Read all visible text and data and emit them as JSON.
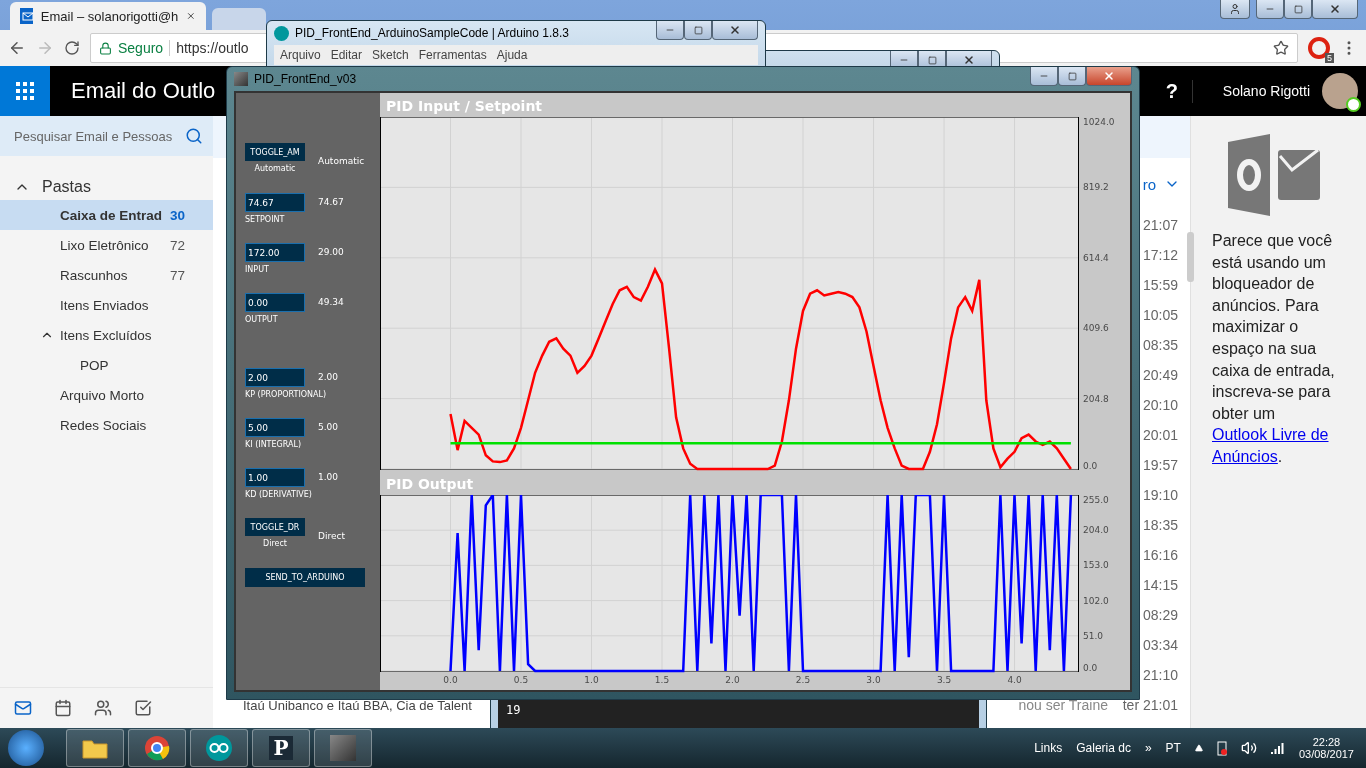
{
  "browser": {
    "tabs": [
      {
        "title": "Email – solanorigotti@h",
        "selected": true
      },
      {
        "selected": false
      }
    ],
    "address_bar": {
      "security": "Seguro",
      "url": "https://outlo"
    },
    "extension_badge": "5"
  },
  "outlook": {
    "app_title": "Email do Outlo",
    "help": "?",
    "user_name": "Solano Rigotti",
    "search": {
      "placeholder": "Pesquisar Email e Pessoas"
    },
    "folders_header": {
      "label": "Pastas",
      "expanded": true
    },
    "folders": [
      {
        "name": "Caixa de Entrad",
        "count": "30",
        "selected": true,
        "expanded": false
      },
      {
        "name": "Lixo Eletrônico",
        "count": "72",
        "selected": false,
        "expanded": false
      },
      {
        "name": "Rascunhos",
        "count": "77",
        "selected": false,
        "expanded": false
      },
      {
        "name": "Itens Enviados",
        "selected": false,
        "expanded": false
      },
      {
        "name": "Itens Excluídos",
        "selected": false,
        "expanded": true,
        "children": [
          {
            "name": "POP",
            "selected": false,
            "expanded": false
          }
        ]
      },
      {
        "name": "Arquivo Morto",
        "selected": false,
        "expanded": false
      },
      {
        "name": "Redes Sociais",
        "selected": false,
        "expanded": false
      }
    ],
    "filter_label": "ro",
    "messages": [
      {
        "time": "21:07"
      },
      {
        "time": "17:12"
      },
      {
        "time": "15:59"
      },
      {
        "time": "10:05"
      },
      {
        "time": "08:35"
      },
      {
        "time": "20:49"
      },
      {
        "time": "20:10"
      },
      {
        "time": "20:01"
      },
      {
        "time": "19:57"
      },
      {
        "time": "19:10"
      },
      {
        "time": "18:35"
      },
      {
        "time": "16:16"
      },
      {
        "time": "14:15"
      },
      {
        "time": "08:29"
      },
      {
        "time": "03:34"
      },
      {
        "time": "21:10"
      },
      {
        "subject": "Itaú Unibanco e Itaú BBA, Cia de Talent",
        "preview": "nou ser Traine",
        "time": "ter 21:01"
      }
    ],
    "ad_text": "Parece que você está usando um bloqueador de anúncios. Para maximizar o espaço na sua caixa de entrada, inscreva-se para obter um",
    "ad_link": [
      "Outlook Livre de",
      "Anúncios"
    ],
    "ad_end": "."
  },
  "arduino": {
    "title": "PID_FrontEnd_ArduinoSampleCode | Arduino 1.8.3",
    "menu": [
      "Arquivo",
      "Editar",
      "Sketch",
      "Ferramentas",
      "Ajuda"
    ],
    "console_line": "19"
  },
  "pid": {
    "title": "PID_FrontEnd_v03",
    "controls": [
      {
        "kind": "toggle",
        "button": "TOGGLE_AM",
        "label": "Automatic",
        "value": "Automatic"
      },
      {
        "kind": "field",
        "field": "74.67",
        "label": "SETPOINT",
        "value": "74.67"
      },
      {
        "kind": "field",
        "field": "172.00",
        "label": "INPUT",
        "value": "29.00"
      },
      {
        "kind": "field",
        "field": "0.00",
        "label": "OUTPUT",
        "value": "49.34"
      },
      {
        "kind": "field",
        "field": "2.00",
        "label": "KP (PROPORTIONAL)",
        "value": "2.00"
      },
      {
        "kind": "field",
        "field": "5.00",
        "label": "KI (INTEGRAL)",
        "value": "5.00"
      },
      {
        "kind": "field",
        "field": "1.00",
        "label": "KD (DERIVATIVE)",
        "value": "1.00"
      },
      {
        "kind": "toggle",
        "button": "TOGGLE_DR",
        "label": "Direct",
        "value": "Direct"
      }
    ],
    "send_button": "SEND_TO_ARDUINO",
    "charts": [
      {
        "title": "PID Input / Setpoint",
        "chart_data": {
          "type": "line",
          "grid": true,
          "xlim": [
            -0.5,
            4.45
          ],
          "ylim": [
            0,
            1024
          ],
          "yticks": [
            {
              "value": 0,
              "label": "0.0"
            },
            {
              "value": 204.8,
              "label": "204.8"
            },
            {
              "value": 409.6,
              "label": "409.6"
            },
            {
              "value": 614.4,
              "label": "614.4"
            },
            {
              "value": 819.2,
              "label": "819.2"
            },
            {
              "value": 1024,
              "label": "1024.0"
            }
          ],
          "x": [
            0,
            0.05,
            0.1,
            0.15,
            0.2,
            0.25,
            0.3,
            0.35,
            0.4,
            0.45,
            0.5,
            0.55,
            0.6,
            0.65,
            0.7,
            0.75,
            0.8,
            0.85,
            0.9,
            0.95,
            1,
            1.05,
            1.1,
            1.15,
            1.2,
            1.25,
            1.3,
            1.35,
            1.4,
            1.45,
            1.5,
            1.55,
            1.6,
            1.65,
            1.7,
            1.75,
            1.8,
            1.85,
            1.9,
            1.95,
            2,
            2.05,
            2.1,
            2.15,
            2.2,
            2.25,
            2.3,
            2.35,
            2.4,
            2.45,
            2.5,
            2.55,
            2.6,
            2.65,
            2.7,
            2.75,
            2.8,
            2.85,
            2.9,
            2.95,
            3,
            3.05,
            3.1,
            3.15,
            3.2,
            3.25,
            3.3,
            3.35,
            3.4,
            3.45,
            3.5,
            3.55,
            3.6,
            3.65,
            3.7,
            3.75,
            3.8,
            3.85,
            3.9,
            3.95,
            4,
            4.05,
            4.1,
            4.15,
            4.2,
            4.25,
            4.3,
            4.35,
            4.4
          ],
          "series": [
            {
              "color": "#ff0000",
              "values": [
                160,
                55,
                140,
                120,
                100,
                40,
                22,
                20,
                25,
                60,
                120,
                200,
                280,
                330,
                370,
                380,
                350,
                330,
                280,
                300,
                330,
                380,
                430,
                480,
                520,
                530,
                500,
                490,
                530,
                580,
                540,
                350,
                150,
                60,
                15,
                0,
                0,
                0,
                0,
                0,
                0,
                0,
                0,
                0,
                0,
                0,
                10,
                80,
                200,
                350,
                460,
                510,
                520,
                505,
                510,
                515,
                510,
                500,
                470,
                400,
                300,
                200,
                120,
                60,
                10,
                0,
                0,
                0,
                50,
                130,
                250,
                380,
                470,
                500,
                460,
                550,
                200,
                60,
                5,
                30,
                50,
                90,
                100,
                80,
                70,
                80,
                60,
                30,
                0
              ]
            },
            {
              "color": "#00e000",
              "values": [
                74.67,
                74.67,
                74.67,
                74.67,
                74.67,
                74.67,
                74.67,
                74.67,
                74.67,
                74.67,
                74.67,
                74.67,
                74.67,
                74.67,
                74.67,
                74.67,
                74.67,
                74.67,
                74.67,
                74.67,
                74.67,
                74.67,
                74.67,
                74.67,
                74.67,
                74.67,
                74.67,
                74.67,
                74.67,
                74.67,
                74.67,
                74.67,
                74.67,
                74.67,
                74.67,
                74.67,
                74.67,
                74.67,
                74.67,
                74.67,
                74.67,
                74.67,
                74.67,
                74.67,
                74.67,
                74.67,
                74.67,
                74.67,
                74.67,
                74.67,
                74.67,
                74.67,
                74.67,
                74.67,
                74.67,
                74.67,
                74.67,
                74.67,
                74.67,
                74.67,
                74.67,
                74.67,
                74.67,
                74.67,
                74.67,
                74.67,
                74.67,
                74.67,
                74.67,
                74.67,
                74.67,
                74.67,
                74.67,
                74.67,
                74.67,
                74.67,
                74.67,
                74.67,
                74.67,
                74.67,
                74.67,
                74.67,
                74.67,
                74.67,
                74.67,
                74.67,
                74.67,
                74.67,
                74.67
              ]
            }
          ]
        }
      },
      {
        "title": "PID Output",
        "chart_data": {
          "type": "line",
          "grid": true,
          "xlim": [
            -0.5,
            4.45
          ],
          "ylim": [
            0,
            255
          ],
          "xticks": [
            {
              "value": 0,
              "label": "0.0"
            },
            {
              "value": 0.5,
              "label": "0.5"
            },
            {
              "value": 1,
              "label": "1.0"
            },
            {
              "value": 1.5,
              "label": "1.5"
            },
            {
              "value": 2,
              "label": "2.0"
            },
            {
              "value": 2.5,
              "label": "2.5"
            },
            {
              "value": 3,
              "label": "3.0"
            },
            {
              "value": 3.5,
              "label": "3.5"
            },
            {
              "value": 4,
              "label": "4.0"
            }
          ],
          "yticks": [
            {
              "value": 0,
              "label": "0.0"
            },
            {
              "value": 51,
              "label": "51.0"
            },
            {
              "value": 102,
              "label": "102.0"
            },
            {
              "value": 153,
              "label": "153.0"
            },
            {
              "value": 204,
              "label": "204.0"
            },
            {
              "value": 255,
              "label": "255.0"
            }
          ],
          "x": [
            0,
            0.05,
            0.1,
            0.15,
            0.2,
            0.25,
            0.3,
            0.35,
            0.4,
            0.45,
            0.5,
            0.55,
            0.6,
            0.65,
            0.7,
            0.75,
            0.8,
            0.85,
            0.9,
            0.95,
            1,
            1.05,
            1.1,
            1.15,
            1.2,
            1.25,
            1.3,
            1.35,
            1.4,
            1.45,
            1.5,
            1.55,
            1.6,
            1.65,
            1.7,
            1.75,
            1.8,
            1.85,
            1.9,
            1.95,
            2,
            2.05,
            2.1,
            2.15,
            2.2,
            2.25,
            2.3,
            2.35,
            2.4,
            2.45,
            2.5,
            2.55,
            2.6,
            2.65,
            2.7,
            2.75,
            2.8,
            2.85,
            2.9,
            2.95,
            3,
            3.05,
            3.1,
            3.15,
            3.2,
            3.25,
            3.3,
            3.35,
            3.4,
            3.45,
            3.5,
            3.55,
            3.6,
            3.65,
            3.7,
            3.75,
            3.8,
            3.85,
            3.9,
            3.95,
            4,
            4.05,
            4.1,
            4.15,
            4.2,
            4.25,
            4.3,
            4.35,
            4.4
          ],
          "series": [
            {
              "color": "#0000ff",
              "values": [
                0,
                200,
                0,
                255,
                30,
                240,
                255,
                0,
                255,
                0,
                255,
                10,
                0,
                0,
                0,
                0,
                0,
                0,
                0,
                0,
                0,
                0,
                0,
                0,
                0,
                0,
                0,
                0,
                0,
                0,
                0,
                0,
                0,
                0,
                255,
                0,
                255,
                40,
                255,
                0,
                255,
                80,
                255,
                0,
                255,
                255,
                255,
                255,
                0,
                255,
                0,
                0,
                0,
                0,
                0,
                0,
                0,
                0,
                0,
                0,
                0,
                0,
                255,
                0,
                255,
                20,
                255,
                255,
                255,
                0,
                255,
                0,
                0,
                0,
                0,
                0,
                0,
                0,
                255,
                0,
                255,
                40,
                255,
                0,
                255,
                30,
                255,
                0,
                255
              ]
            }
          ]
        }
      }
    ]
  },
  "taskbar": {
    "apps": [
      {
        "kind": "folder"
      },
      {
        "kind": "chrome"
      },
      {
        "kind": "arduino"
      },
      {
        "kind": "letter",
        "label": "P"
      },
      {
        "kind": "sketch"
      }
    ],
    "links": "Links",
    "toolbar_item": "Galeria dc",
    "overflow": "»",
    "language": "PT",
    "time": "22:28",
    "date": "03/08/2017"
  }
}
